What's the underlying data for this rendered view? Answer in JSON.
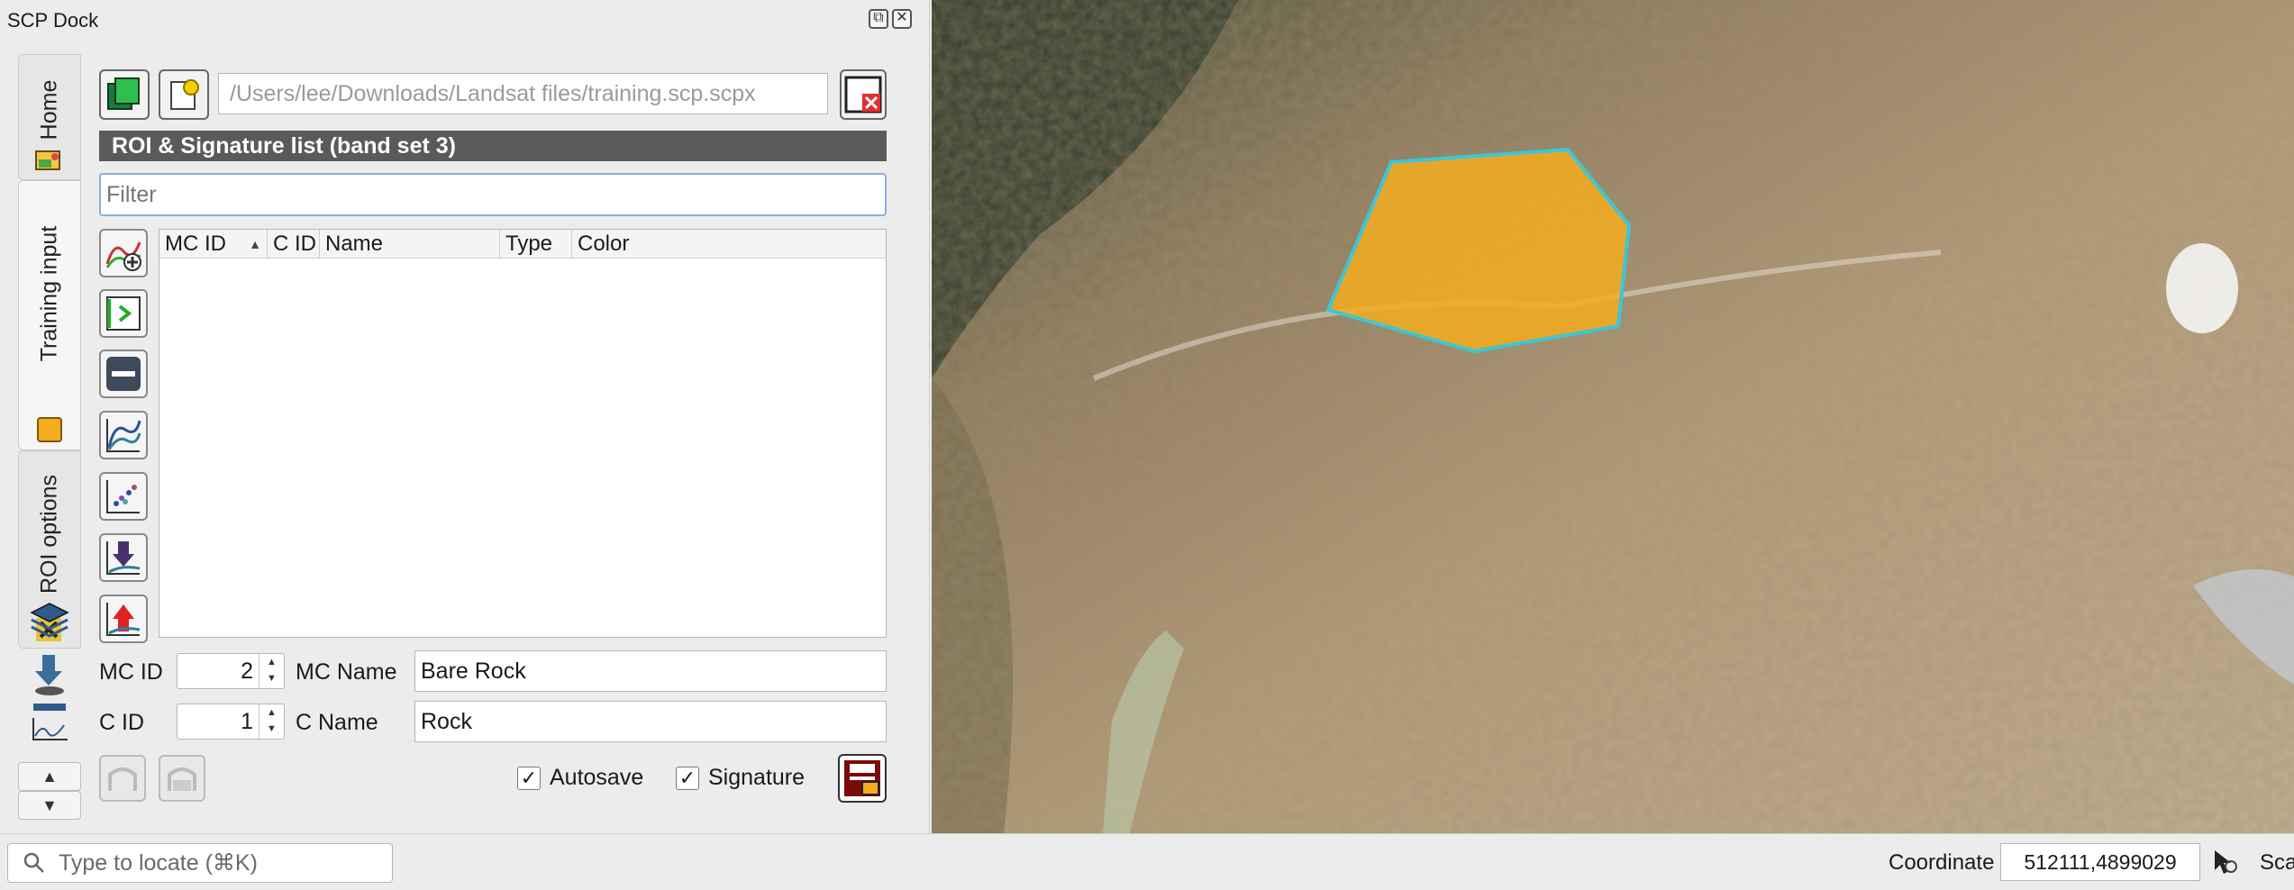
{
  "dock": {
    "title": "SCP Dock",
    "float_icon": "float-icon",
    "close_icon": "close-icon"
  },
  "tabs": {
    "home": "Home",
    "training_input": "Training input",
    "roi_options": "ROI options"
  },
  "file": {
    "path_placeholder": "/Users/lee/Downloads/Landsat files/training.scp.scpx"
  },
  "section": {
    "title": "ROI & Signature list (band set 3)"
  },
  "filter": {
    "placeholder": "Filter"
  },
  "table": {
    "columns": [
      "MC ID",
      "C ID",
      "Name",
      "Type",
      "Color"
    ],
    "rows": []
  },
  "form": {
    "mc_id_label": "MC ID",
    "mc_id_value": "2",
    "mc_name_label": "MC Name",
    "mc_name_value": "Bare Rock",
    "c_id_label": "C ID",
    "c_id_value": "1",
    "c_name_label": "C Name",
    "c_name_value": "Rock",
    "autosave_label": "Autosave",
    "autosave_checked": true,
    "signature_label": "Signature",
    "signature_checked": true,
    "check_mark": "✓"
  },
  "status": {
    "locate_placeholder": "Type to locate (⌘K)",
    "coordinate_label": "Coordinate",
    "coordinate_value": "512111,4899029",
    "scale_label": "Sca"
  },
  "colors": {
    "roi_fill": "#f3ad1f",
    "roi_stroke": "#3cc6d6",
    "header_bar": "#5a5a5a"
  }
}
